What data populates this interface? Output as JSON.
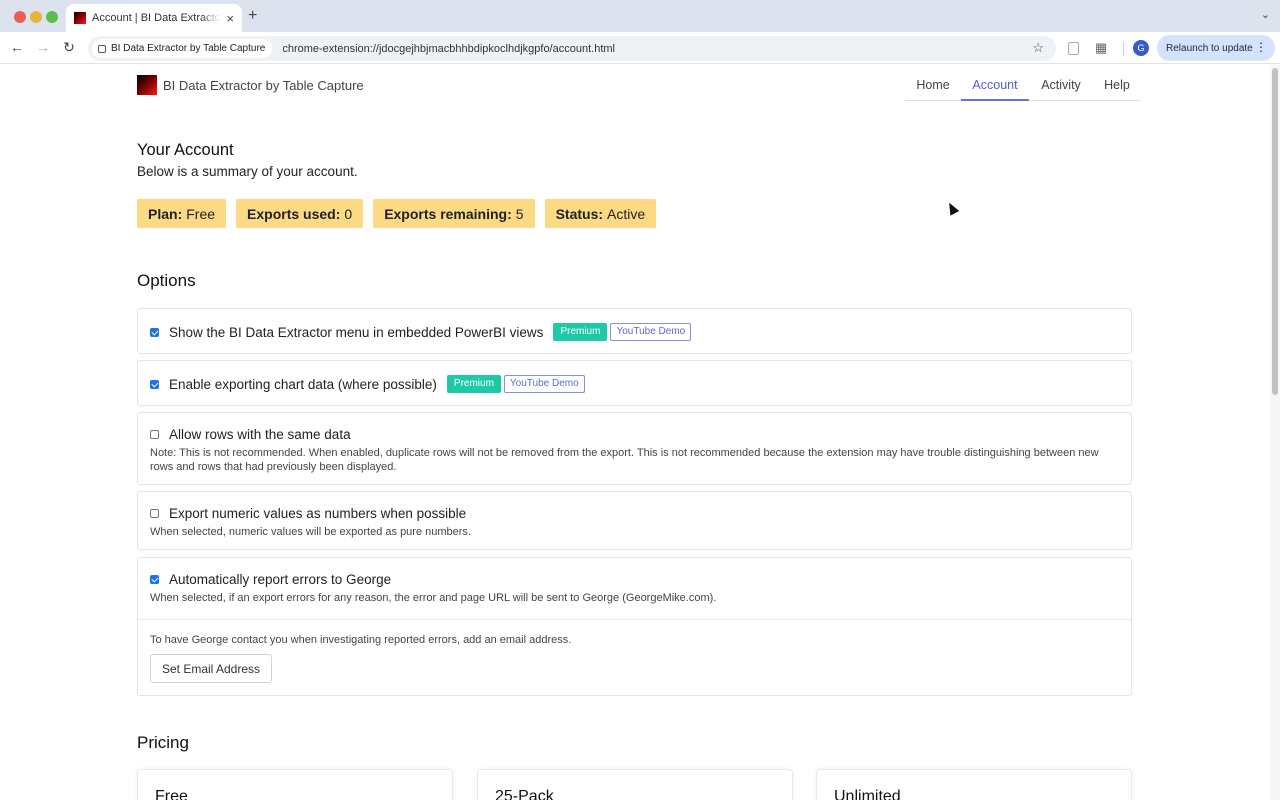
{
  "browser": {
    "tab_title": "Account | BI Data Extractor by Table Capture",
    "tab_close": "×",
    "new_tab": "+",
    "tab_menu": "⌄",
    "site_chip": "BI Data Extractor by Table Capture",
    "url": "chrome-extension://jdocgejhbjmacbhhbdipkoclhdjkgpfo/account.html",
    "profile_initial": "G",
    "relaunch_label": "Relaunch to update"
  },
  "header": {
    "brand": "BI Data Extractor by Table Capture",
    "nav": [
      {
        "label": "Home",
        "active": false
      },
      {
        "label": "Account",
        "active": true
      },
      {
        "label": "Activity",
        "active": false
      },
      {
        "label": "Help",
        "active": false
      }
    ]
  },
  "account": {
    "title": "Your Account",
    "subtitle": "Below is a summary of your account.",
    "stats": [
      {
        "key": "Plan:",
        "value": "Free"
      },
      {
        "key": "Exports used:",
        "value": "0"
      },
      {
        "key": "Exports remaining:",
        "value": "5"
      },
      {
        "key": "Status:",
        "value": "Active"
      }
    ]
  },
  "options": {
    "title": "Options",
    "items": [
      {
        "label": "Show the BI Data Extractor menu in embedded PowerBI views",
        "checked": true,
        "premium": "Premium",
        "demo": "YouTube Demo"
      },
      {
        "label": "Enable exporting chart data (where possible)",
        "checked": true,
        "premium": "Premium",
        "demo": "YouTube Demo"
      },
      {
        "label": "Allow rows with the same data",
        "checked": false,
        "note": "Note: This is not recommended. When enabled, duplicate rows will not be removed from the export. This is not recommended because the extension may have trouble distinguishing between new rows and rows that had previously been displayed."
      },
      {
        "label": "Export numeric values as numbers when possible",
        "checked": false,
        "note": "When selected, numeric values will be exported as pure numbers."
      },
      {
        "label": "Automatically report errors to George",
        "checked": true,
        "note": "When selected, if an export errors for any reason, the error and page URL will be sent to George (GeorgeMike.com)."
      }
    ],
    "email_note": "To have George contact you when investigating reported errors, add an email address.",
    "email_button": "Set Email Address"
  },
  "pricing": {
    "title": "Pricing",
    "cards": [
      "Free",
      "25-Pack",
      "Unlimited"
    ]
  },
  "colors": {
    "stat_badge": "#fbd985",
    "premium": "#1ec9a5",
    "accent": "#4f5fcc"
  }
}
